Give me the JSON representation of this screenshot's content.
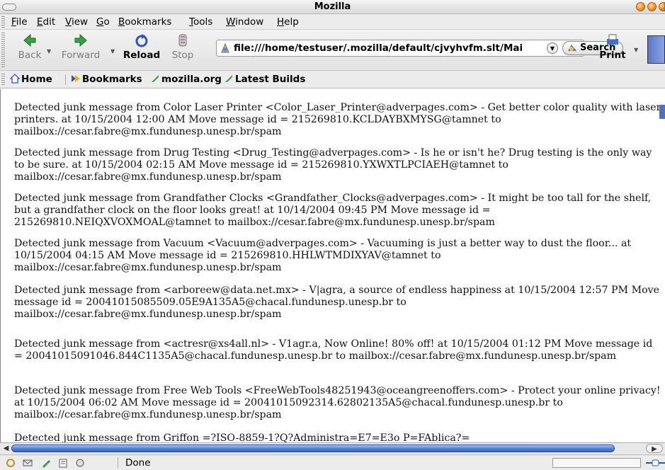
{
  "window": {
    "title": "Mozilla"
  },
  "menu": [
    {
      "key": "F",
      "rest": "ile"
    },
    {
      "key": "E",
      "rest": "dit"
    },
    {
      "key": "V",
      "rest": "iew"
    },
    {
      "key": "G",
      "rest": "o"
    },
    {
      "key": "B",
      "rest": "ookmarks"
    },
    {
      "key": "T",
      "rest": "ools"
    },
    {
      "key": "W",
      "rest": "indow"
    },
    {
      "key": "H",
      "rest": "elp"
    }
  ],
  "nav": {
    "back": "Back",
    "forward": "Forward",
    "reload": "Reload",
    "stop": "Stop",
    "url": "file:///home/testuser/.mozilla/default/cjvyhvfm.slt/Mai",
    "search": "Search",
    "print": "Print"
  },
  "personal": {
    "home": "Home",
    "bookmarks": "Bookmarks",
    "mozilla_org": "mozilla.org",
    "latest_builds": "Latest Builds"
  },
  "messages": [
    "Detected junk message from Color Laser Printer <Color_Laser_Printer@adverpages.com> - Get better color quality with laser printers. at 10/15/2004 12:00 AM Move message id = 215269810.KCLDAYBXMYSG@tamnet to mailbox://cesar.fabre@mx.fundunesp.unesp.br/spam",
    "Detected junk message from Drug Testing <Drug_Testing@adverpages.com> - Is he or isn't he? Drug testing is the only way to be sure. at 10/15/2004 02:15 AM Move message id = 215269810.YXWXTLPCIAEH@tamnet to mailbox://cesar.fabre@mx.fundunesp.unesp.br/spam",
    "Detected junk message from Grandfather Clocks <Grandfather_Clocks@adverpages.com> - It might be too tall for the shelf, but a grandfather clock on the floor looks great! at 10/14/2004 09:45 PM Move message id = 215269810.NEIQXVOXMOAL@tamnet to mailbox://cesar.fabre@mx.fundunesp.unesp.br/spam",
    "Detected junk message from Vacuum <Vacuum@adverpages.com> - Vacuuming is just a better way to dust the floor... at 10/15/2004 04:15 AM Move message id = 215269810.HHLWTMDIXYAV@tamnet to mailbox://cesar.fabre@mx.fundunesp.unesp.br/spam",
    "Detected junk message from <arboreew@data.net.mx> - V|agra, a source of endless happiness at 10/15/2004 12:57 PM Move message id = 20041015085509.05E9A135A5@chacal.fundunesp.unesp.br to mailbox://cesar.fabre@mx.fundunesp.unesp.br/spam",
    "Detected junk message from <actresr@xs4all.nl> - V1agr.a, Now Online! 80% off! at 10/15/2004 01:12 PM Move message id = 20041015091046.844C1135A5@chacal.fundunesp.unesp.br to mailbox://cesar.fabre@mx.fundunesp.unesp.br/spam",
    "Detected junk message from Free Web Tools <FreeWebTools48251943@oceangreenoffers.com> - Protect your online privacy! at 10/15/2004 06:02 AM Move message id = 20041015092314.62802135A5@chacal.fundunesp.unesp.br to mailbox://cesar.fabre@mx.fundunesp.unesp.br/spam",
    "Detected junk message from Griffon =?ISO-8859-1?Q?Administra=E7=E3o P=FAblica?="
  ],
  "status": {
    "text": "Done"
  }
}
